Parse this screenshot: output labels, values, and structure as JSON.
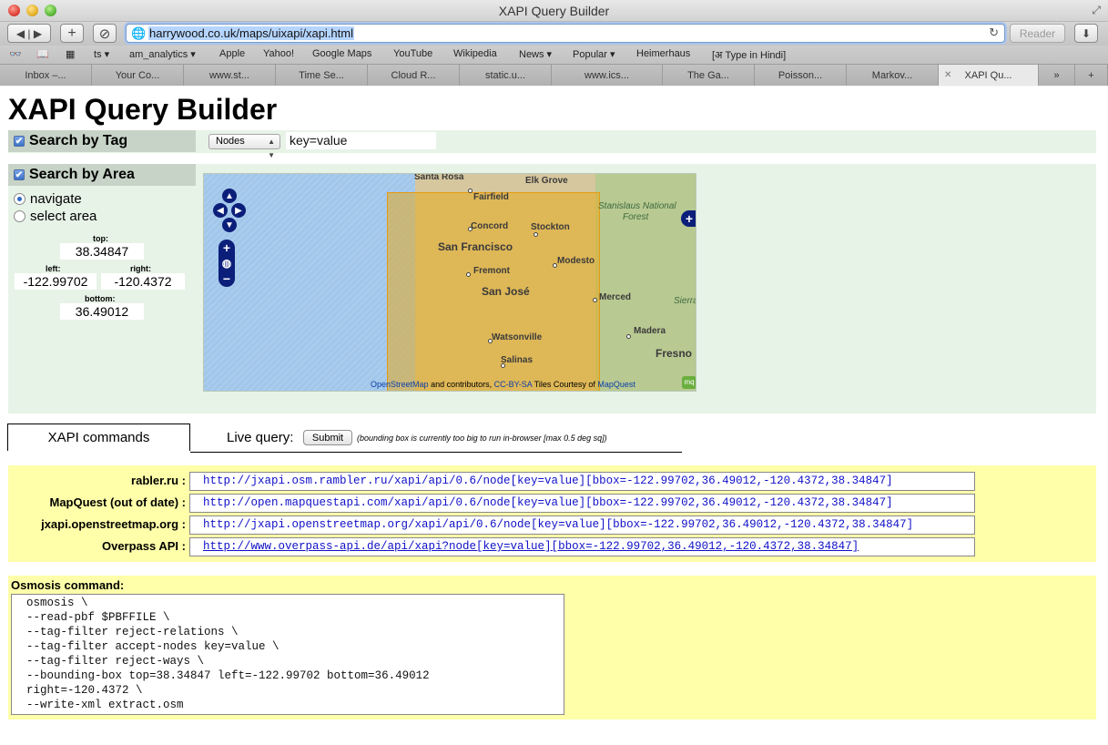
{
  "window": {
    "title": "XAPI Query Builder"
  },
  "toolbar": {
    "url": "harrywood.co.uk/maps/uixapi/xapi.html",
    "reader_label": "Reader"
  },
  "bookmarks": [
    "ts ▾",
    "am_analytics ▾",
    "Apple",
    "Yahoo!",
    "Google Maps",
    "YouTube",
    "Wikipedia",
    "News ▾",
    "Popular ▾",
    "Heimerhaus",
    "[अ Type in Hindi]"
  ],
  "tabs": [
    "Inbox –...",
    "Your Co...",
    "www.st...",
    "Time Se...",
    "Cloud R...",
    "static.u...",
    "www.ics...",
    "The Ga...",
    "Poisson...",
    "Markov...",
    "XAPI Qu..."
  ],
  "page": {
    "title": "XAPI Query Builder",
    "search_tag": {
      "label": "Search by Tag",
      "element_type": "Nodes",
      "kv_value": "key=value"
    },
    "search_area": {
      "label": "Search by Area",
      "navigate_label": "navigate",
      "select_area_label": "select area",
      "top_label": "top:",
      "top": "38.34847",
      "left_label": "left:",
      "left": "-122.99702",
      "right_label": "right:",
      "right": "-120.4372",
      "bottom_label": "bottom:",
      "bottom": "36.49012"
    },
    "map": {
      "labels": [
        "Santa Rosa",
        "Elk Grove",
        "Fairfield",
        "Concord",
        "Stockton",
        "San Francisco",
        "Modesto",
        "Fremont",
        "San José",
        "Merced",
        "Watsonville",
        "Madera",
        "Salinas",
        "Fresno",
        "Stanislaus National",
        "Forest",
        "Sierra"
      ],
      "attribution_osm": "OpenStreetMap",
      "attribution_mid": "and contributors,",
      "attribution_cc": "CC-BY-SA",
      "attribution_tiles": "Tiles Courtesy of",
      "attribution_mq": "MapQuest"
    },
    "commands_tab": "XAPI commands",
    "live_query_label": "Live query:",
    "submit_label": "Submit",
    "live_note": "(bounding box is currently too big to run in-browser [max 0.5 deg sq])",
    "apis": [
      {
        "name": "rabler.ru :",
        "url": "http://jxapi.osm.rambler.ru/xapi/api/0.6/node[key=value][bbox=-122.99702,36.49012,-120.4372,38.34847]"
      },
      {
        "name": "MapQuest (out of date) :",
        "url": "http://open.mapquestapi.com/xapi/api/0.6/node[key=value][bbox=-122.99702,36.49012,-120.4372,38.34847]"
      },
      {
        "name": "jxapi.openstreetmap.org :",
        "url": "http://jxapi.openstreetmap.org/xapi/api/0.6/node[key=value][bbox=-122.99702,36.49012,-120.4372,38.34847]"
      },
      {
        "name": "Overpass API :",
        "url": "http://www.overpass-api.de/api/xapi?node[key=value][bbox=-122.99702,36.49012,-120.4372,38.34847]"
      }
    ],
    "osmosis": {
      "title": "Osmosis command:",
      "lines": [
        "osmosis \\",
        "--read-pbf $PBFFILE \\",
        "--tag-filter reject-relations \\",
        "--tag-filter accept-nodes key=value \\",
        "--tag-filter reject-ways \\",
        "--bounding-box top=38.34847 left=-122.99702 bottom=36.49012",
        "right=-120.4372 \\",
        "--write-xml extract.osm"
      ]
    }
  }
}
